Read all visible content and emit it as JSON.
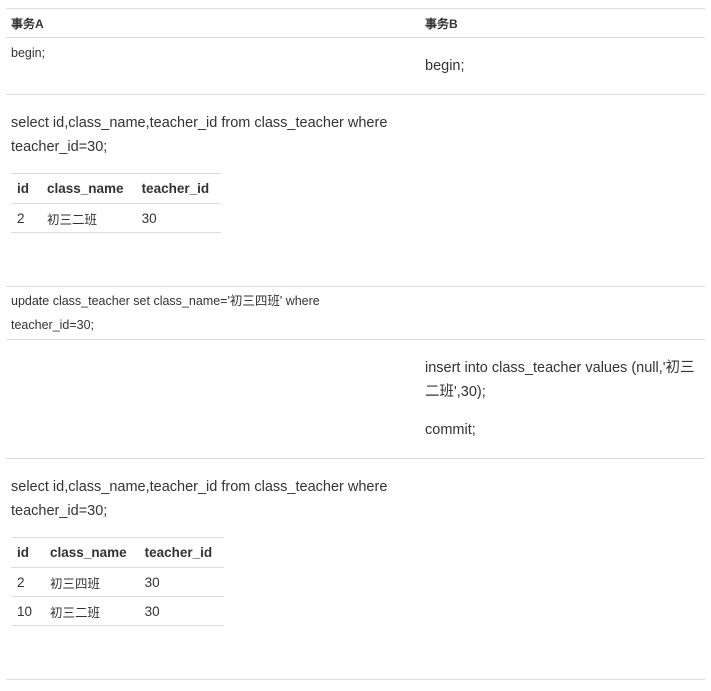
{
  "header": {
    "col_a": "事务A",
    "col_b": "事务B"
  },
  "rows": [
    {
      "a": "begin;",
      "b": "begin;"
    },
    {
      "a": "select id,class_name,teacher_id from class_teacher where teacher_id=30;"
    },
    {
      "a": "update class_teacher set class_name='初三四班' where teacher_id=30;"
    },
    {
      "b_insert": "insert into class_teacher values (null,'初三二班',30);",
      "b_commit": "commit;"
    },
    {
      "a": "select id,class_name,teacher_id from class_teacher where teacher_id=30;"
    }
  ],
  "result1": {
    "headers": [
      "id",
      "class_name",
      "teacher_id"
    ],
    "rows": [
      [
        "2",
        "初三二班",
        "30"
      ]
    ]
  },
  "result2": {
    "headers": [
      "id",
      "class_name",
      "teacher_id"
    ],
    "rows": [
      [
        "2",
        "初三四班",
        "30"
      ],
      [
        "10",
        "初三二班",
        "30"
      ]
    ]
  }
}
